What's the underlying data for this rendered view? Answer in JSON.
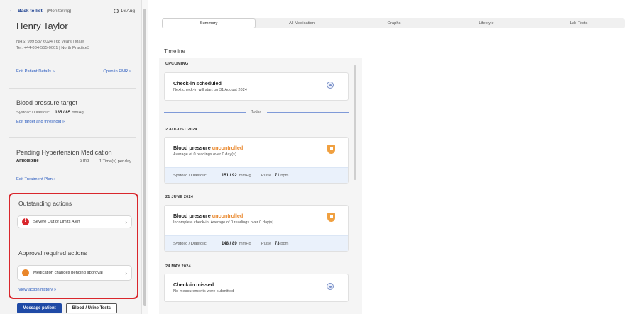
{
  "sidebar": {
    "back_label": "Back to list",
    "back_context": "(Monitoring)",
    "date": "16 Aug",
    "patient_name": "Henry Taylor",
    "patient_line1": "NHS: 999 537 6024  |  68 years  |  Male",
    "patient_line2": "Tel: +44-034-555-0001  |  North Practice3",
    "edit_details": "Edit Patient Details »",
    "open_emr": "Open in EMR »",
    "bp_target_title": "Blood pressure target",
    "bp_target_label": "Systolic / Diastolic",
    "bp_target_value": "135 / 85",
    "bp_target_unit": "mmHg",
    "edit_target": "Edit target and threshold »",
    "pending_title": "Pending Hypertension Medication",
    "med_name": "Amlodipine",
    "med_dose": "5 mg",
    "med_freq": "1 Time(s) per day",
    "edit_treatment": "Edit Treatment Plan »",
    "outstanding_title": "Outstanding actions",
    "outstanding_item": "Severe Out of Limits Alert",
    "approval_title": "Approval required actions",
    "approval_item": "Medication changes pending approval",
    "view_history": "View action history »",
    "message_btn": "Message patient",
    "tests_btn": "Blood / Urine Tests"
  },
  "tabs": [
    "Summary",
    "All Medication",
    "Graphs",
    "Lifestyle",
    "Lab Tests"
  ],
  "timeline": {
    "title": "Timeline",
    "upcoming_label": "UPCOMING",
    "today_label": "Today",
    "checkin_title": "Check-in scheduled",
    "checkin_sub": "Next check-in will start on 31 August 2024",
    "group2": "2 AUGUST 2024",
    "card2_title": "Blood pressure",
    "card2_status": "uncontrolled",
    "card2_sub": "Average of 0 readings over 0 day(s)",
    "card2_label": "Systolic / Diastolic",
    "card2_value": "151 / 92",
    "card2_unit": "mmHg",
    "card2_pulse_label": "Pulse",
    "card2_pulse": "71",
    "card2_pulse_unit": "bpm",
    "group3": "21 JUNE 2024",
    "card3_title": "Blood pressure",
    "card3_status": "uncontrolled",
    "card3_sub": "Incomplete check-in: Average of 0 readings over 0 day(s)",
    "card3_label": "Systolic / Diastolic",
    "card3_value": "148 / 89",
    "card3_unit": "mmHg",
    "card3_pulse_label": "Pulse",
    "card3_pulse": "73",
    "card3_pulse_unit": "bpm",
    "group4": "24 MAY 2024",
    "card4_title": "Check-in missed",
    "card4_sub": "No measurements were submitted"
  },
  "colors": {
    "alert_red": "#d9262c",
    "status_orange": "#e9862a",
    "primary_blue": "#1f4aa6",
    "link_blue": "#2a5bbf"
  }
}
